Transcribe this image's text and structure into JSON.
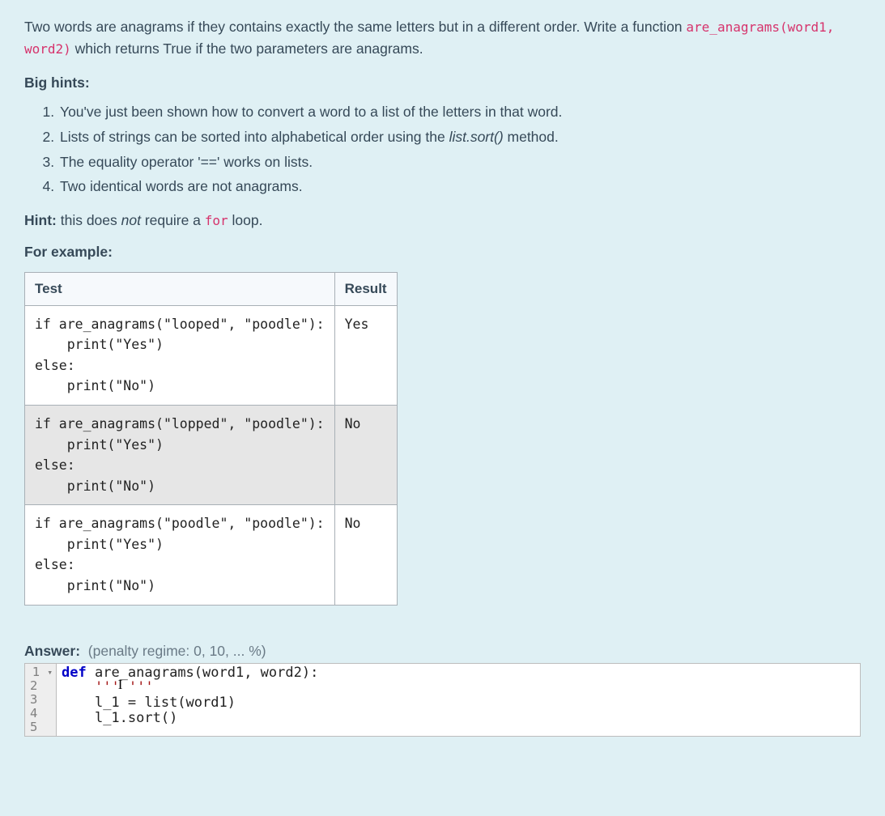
{
  "intro": {
    "text_before_code": "Two words are anagrams if they contains exactly the same letters but in a different order. Write a function ",
    "code": "are_anagrams(word1, word2)",
    "text_after_code": " which returns True if the two parameters are anagrams."
  },
  "big_hints_label": "Big hints:",
  "hints": [
    {
      "text": "You've just been shown how to convert a word to a list of the letters in that word."
    },
    {
      "before": "Lists of strings can be sorted into alphabetical order using the ",
      "method": "list.sort()",
      "after": " method."
    },
    {
      "text": "The equality operator '==' works on lists."
    },
    {
      "text": "Two identical words are not anagrams."
    }
  ],
  "hint_line": {
    "label": "Hint:",
    "before": " this does ",
    "em": "not",
    "mid": " require a ",
    "code": "for",
    "after": " loop."
  },
  "for_example_label": "For example:",
  "table": {
    "headers": {
      "test": "Test",
      "result": "Result"
    },
    "rows": [
      {
        "test": "if are_anagrams(\"looped\", \"poodle\"):\n    print(\"Yes\")\nelse:\n    print(\"No\")",
        "result": "Yes"
      },
      {
        "test": "if are_anagrams(\"lopped\", \"poodle\"):\n    print(\"Yes\")\nelse:\n    print(\"No\")",
        "result": "No"
      },
      {
        "test": "if are_anagrams(\"poodle\", \"poodle\"):\n    print(\"Yes\")\nelse:\n    print(\"No\")",
        "result": "No"
      }
    ]
  },
  "answer": {
    "label": "Answer:",
    "penalty": "(penalty regime: 0, 10, ... %)"
  },
  "editor": {
    "gutter_lines": [
      "1",
      "2",
      "3",
      "4",
      "5"
    ],
    "fold_marker": "▾",
    "code": {
      "l1": {
        "kw": "def",
        "rest": " are_anagrams(word1, word2):"
      },
      "l2": {
        "indent": "    ",
        "str": "''' '''"
      },
      "l3": "    l_1 = list(word1)",
      "l4": "    l_1.sort()",
      "l5": ""
    }
  }
}
